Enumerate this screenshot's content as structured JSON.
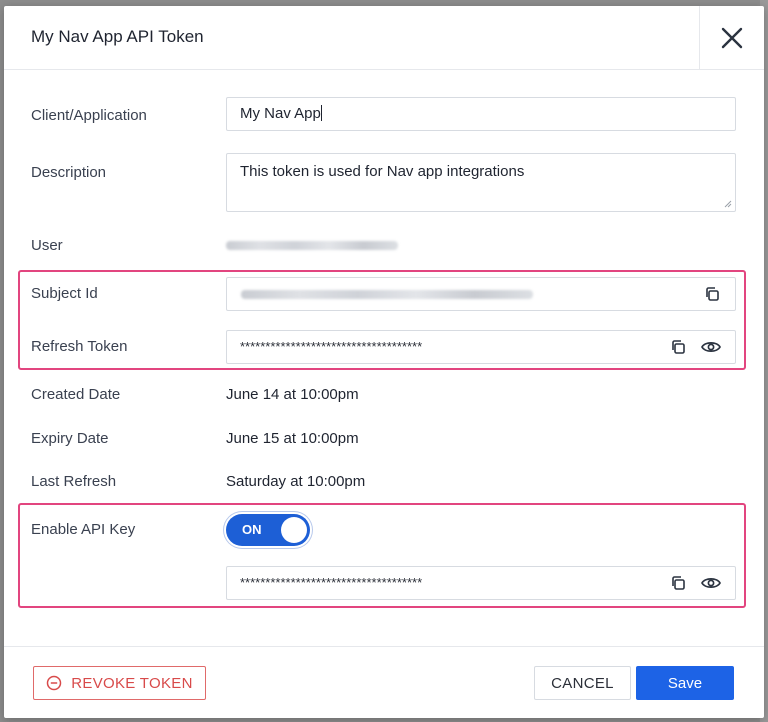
{
  "dialog": {
    "title": "My Nav App API Token"
  },
  "fields": {
    "client": {
      "label": "Client/Application",
      "value": "My Nav App"
    },
    "description": {
      "label": "Description",
      "value": "This token is used for Nav app integrations"
    },
    "user": {
      "label": "User"
    },
    "subject_id": {
      "label": "Subject Id"
    },
    "refresh_token": {
      "label": "Refresh Token",
      "value": "************************************"
    },
    "created_date": {
      "label": "Created Date",
      "value": "June 14 at 10:00pm"
    },
    "expiry_date": {
      "label": "Expiry Date",
      "value": "June 15 at 10:00pm"
    },
    "last_refresh": {
      "label": "Last Refresh",
      "value": "Saturday at 10:00pm"
    },
    "api_key": {
      "label": "Enable API Key",
      "toggle": "ON",
      "value": "************************************"
    }
  },
  "footer": {
    "revoke_label": "REVOKE TOKEN",
    "cancel_label": "CANCEL",
    "save_label": "Save"
  },
  "icons": {
    "close": "close-icon",
    "copy": "copy-icon",
    "eye": "eye-icon",
    "revoke": "minus-circle-icon"
  },
  "colors": {
    "primary": "#1d63e6",
    "danger": "#d84a4a",
    "highlight": "#e2457f"
  }
}
